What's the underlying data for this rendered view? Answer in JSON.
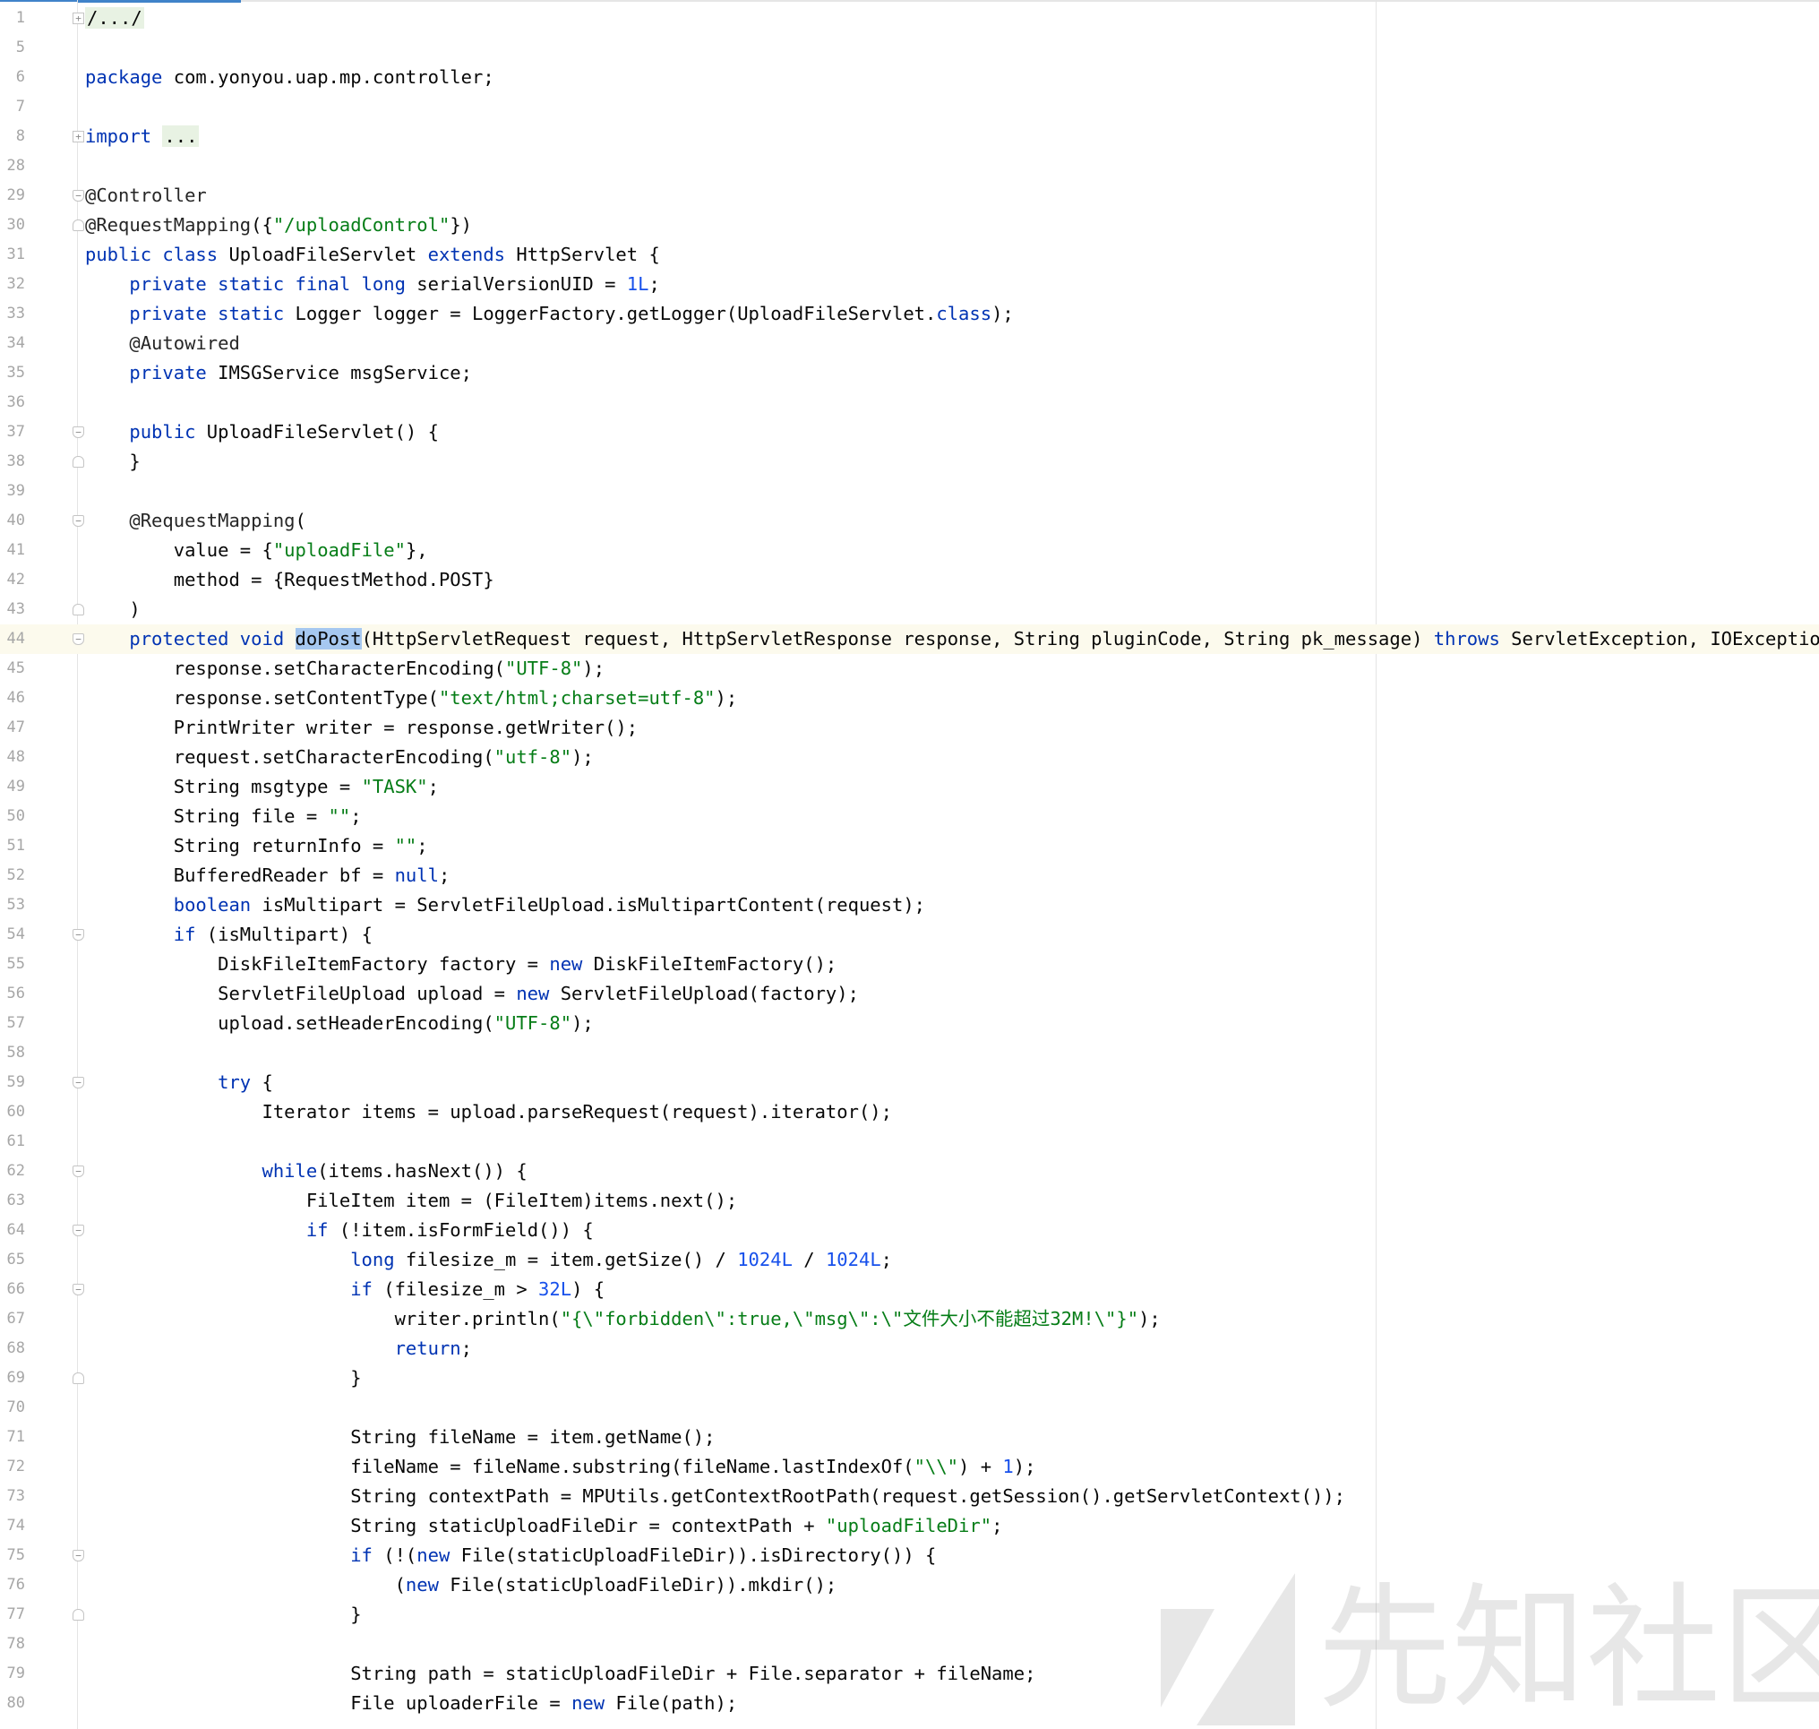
{
  "editor": {
    "lines": [
      {
        "n": "1",
        "fold": "expand",
        "tokens": [
          {
            "t": "/.../",
            "c": "fold-region"
          }
        ]
      },
      {
        "n": "5",
        "tokens": []
      },
      {
        "n": "6",
        "tokens": [
          {
            "t": "package",
            "c": "kw"
          },
          {
            "t": " com.yonyou.uap.mp.controller;"
          }
        ]
      },
      {
        "n": "7",
        "tokens": []
      },
      {
        "n": "8",
        "fold": "expand",
        "tokens": [
          {
            "t": "import",
            "c": "kw"
          },
          {
            "t": " "
          },
          {
            "t": "...",
            "c": "fold-region"
          }
        ]
      },
      {
        "n": "28",
        "tokens": []
      },
      {
        "n": "29",
        "fold": "close",
        "tokens": [
          {
            "t": "@Controller",
            "c": "ann"
          }
        ]
      },
      {
        "n": "30",
        "fold": "open",
        "tokens": [
          {
            "t": "@RequestMapping",
            "c": "ann"
          },
          {
            "t": "({"
          },
          {
            "t": "\"/uploadControl\"",
            "c": "str"
          },
          {
            "t": "})"
          }
        ]
      },
      {
        "n": "31",
        "tokens": [
          {
            "t": "public class",
            "c": "kw"
          },
          {
            "t": " UploadFileServlet "
          },
          {
            "t": "extends",
            "c": "kw"
          },
          {
            "t": " HttpServlet {"
          }
        ]
      },
      {
        "n": "32",
        "tokens": [
          {
            "t": "    "
          },
          {
            "t": "private static final long",
            "c": "kw"
          },
          {
            "t": " serialVersionUID = "
          },
          {
            "t": "1L",
            "c": "num"
          },
          {
            "t": ";"
          }
        ]
      },
      {
        "n": "33",
        "tokens": [
          {
            "t": "    "
          },
          {
            "t": "private static",
            "c": "kw"
          },
          {
            "t": " Logger logger = LoggerFactory.getLogger(UploadFileServlet."
          },
          {
            "t": "class",
            "c": "kw"
          },
          {
            "t": ");"
          }
        ]
      },
      {
        "n": "34",
        "tokens": [
          {
            "t": "    "
          },
          {
            "t": "@Autowired",
            "c": "ann"
          }
        ]
      },
      {
        "n": "35",
        "tokens": [
          {
            "t": "    "
          },
          {
            "t": "private",
            "c": "kw"
          },
          {
            "t": " IMSGService msgService;"
          }
        ]
      },
      {
        "n": "36",
        "tokens": []
      },
      {
        "n": "37",
        "fold": "close",
        "tokens": [
          {
            "t": "    "
          },
          {
            "t": "public",
            "c": "kw"
          },
          {
            "t": " UploadFileServlet() {"
          }
        ]
      },
      {
        "n": "38",
        "fold": "open",
        "tokens": [
          {
            "t": "    }"
          }
        ]
      },
      {
        "n": "39",
        "tokens": []
      },
      {
        "n": "40",
        "fold": "close",
        "tokens": [
          {
            "t": "    "
          },
          {
            "t": "@RequestMapping",
            "c": "ann"
          },
          {
            "t": "("
          }
        ]
      },
      {
        "n": "41",
        "tokens": [
          {
            "t": "        value = {"
          },
          {
            "t": "\"uploadFile\"",
            "c": "str"
          },
          {
            "t": "},"
          }
        ]
      },
      {
        "n": "42",
        "tokens": [
          {
            "t": "        method = {RequestMethod.POST}"
          }
        ]
      },
      {
        "n": "43",
        "fold": "open",
        "tokens": [
          {
            "t": "    )"
          }
        ]
      },
      {
        "n": "44",
        "current": true,
        "fold": "close",
        "tokens": [
          {
            "t": "    "
          },
          {
            "t": "protected void",
            "c": "kw"
          },
          {
            "t": " "
          },
          {
            "t": "doPost",
            "c": "sel"
          },
          {
            "t": "(HttpServletRequest request, HttpServletResponse response, String pluginCode, String pk_message) "
          },
          {
            "t": "throws",
            "c": "kw"
          },
          {
            "t": " ServletException, IOException {"
          }
        ]
      },
      {
        "n": "45",
        "tokens": [
          {
            "t": "        response.setCharacterEncoding("
          },
          {
            "t": "\"UTF-8\"",
            "c": "str"
          },
          {
            "t": ");"
          }
        ]
      },
      {
        "n": "46",
        "tokens": [
          {
            "t": "        response.setContentType("
          },
          {
            "t": "\"text/html;charset=utf-8\"",
            "c": "str"
          },
          {
            "t": ");"
          }
        ]
      },
      {
        "n": "47",
        "tokens": [
          {
            "t": "        PrintWriter writer = response.getWriter();"
          }
        ]
      },
      {
        "n": "48",
        "tokens": [
          {
            "t": "        request.setCharacterEncoding("
          },
          {
            "t": "\"utf-8\"",
            "c": "str"
          },
          {
            "t": ");"
          }
        ]
      },
      {
        "n": "49",
        "tokens": [
          {
            "t": "        String msgtype = "
          },
          {
            "t": "\"TASK\"",
            "c": "str"
          },
          {
            "t": ";"
          }
        ]
      },
      {
        "n": "50",
        "tokens": [
          {
            "t": "        String file = "
          },
          {
            "t": "\"\"",
            "c": "str"
          },
          {
            "t": ";"
          }
        ]
      },
      {
        "n": "51",
        "tokens": [
          {
            "t": "        String returnInfo = "
          },
          {
            "t": "\"\"",
            "c": "str"
          },
          {
            "t": ";"
          }
        ]
      },
      {
        "n": "52",
        "tokens": [
          {
            "t": "        BufferedReader bf = "
          },
          {
            "t": "null",
            "c": "kw"
          },
          {
            "t": ";"
          }
        ]
      },
      {
        "n": "53",
        "tokens": [
          {
            "t": "        "
          },
          {
            "t": "boolean",
            "c": "kw"
          },
          {
            "t": " isMultipart = ServletFileUpload.isMultipartContent(request);"
          }
        ]
      },
      {
        "n": "54",
        "fold": "close",
        "tokens": [
          {
            "t": "        "
          },
          {
            "t": "if",
            "c": "kw"
          },
          {
            "t": " (isMultipart) {"
          }
        ]
      },
      {
        "n": "55",
        "tokens": [
          {
            "t": "            DiskFileItemFactory factory = "
          },
          {
            "t": "new",
            "c": "kw"
          },
          {
            "t": " DiskFileItemFactory();"
          }
        ]
      },
      {
        "n": "56",
        "tokens": [
          {
            "t": "            ServletFileUpload upload = "
          },
          {
            "t": "new",
            "c": "kw"
          },
          {
            "t": " ServletFileUpload(factory);"
          }
        ]
      },
      {
        "n": "57",
        "tokens": [
          {
            "t": "            upload.setHeaderEncoding("
          },
          {
            "t": "\"UTF-8\"",
            "c": "str"
          },
          {
            "t": ");"
          }
        ]
      },
      {
        "n": "58",
        "tokens": []
      },
      {
        "n": "59",
        "fold": "close",
        "tokens": [
          {
            "t": "            "
          },
          {
            "t": "try",
            "c": "kw"
          },
          {
            "t": " {"
          }
        ]
      },
      {
        "n": "60",
        "tokens": [
          {
            "t": "                Iterator items = upload.parseRequest(request).iterator();"
          }
        ]
      },
      {
        "n": "61",
        "tokens": []
      },
      {
        "n": "62",
        "fold": "close",
        "tokens": [
          {
            "t": "                "
          },
          {
            "t": "while",
            "c": "kw"
          },
          {
            "t": "(items.hasNext()) {"
          }
        ]
      },
      {
        "n": "63",
        "tokens": [
          {
            "t": "                    FileItem item = (FileItem)items.next();"
          }
        ]
      },
      {
        "n": "64",
        "fold": "close",
        "tokens": [
          {
            "t": "                    "
          },
          {
            "t": "if",
            "c": "kw"
          },
          {
            "t": " (!item.isFormField()) {"
          }
        ]
      },
      {
        "n": "65",
        "tokens": [
          {
            "t": "                        "
          },
          {
            "t": "long",
            "c": "kw"
          },
          {
            "t": " filesize_m = item.getSize() / "
          },
          {
            "t": "1024L",
            "c": "num"
          },
          {
            "t": " / "
          },
          {
            "t": "1024L",
            "c": "num"
          },
          {
            "t": ";"
          }
        ]
      },
      {
        "n": "66",
        "fold": "close",
        "tokens": [
          {
            "t": "                        "
          },
          {
            "t": "if",
            "c": "kw"
          },
          {
            "t": " (filesize_m > "
          },
          {
            "t": "32L",
            "c": "num"
          },
          {
            "t": ") {"
          }
        ]
      },
      {
        "n": "67",
        "tokens": [
          {
            "t": "                            writer.println("
          },
          {
            "t": "\"{\\\"forbidden\\\":true,\\\"msg\\\":\\\"文件大小不能超过32M!\\\"}\"",
            "c": "str"
          },
          {
            "t": ");"
          }
        ]
      },
      {
        "n": "68",
        "tokens": [
          {
            "t": "                            "
          },
          {
            "t": "return",
            "c": "kw"
          },
          {
            "t": ";"
          }
        ]
      },
      {
        "n": "69",
        "fold": "open",
        "tokens": [
          {
            "t": "                        }"
          }
        ]
      },
      {
        "n": "70",
        "tokens": []
      },
      {
        "n": "71",
        "tokens": [
          {
            "t": "                        String fileName = item.getName();"
          }
        ]
      },
      {
        "n": "72",
        "tokens": [
          {
            "t": "                        fileName = fileName.substring(fileName.lastIndexOf("
          },
          {
            "t": "\"\\\\\"",
            "c": "str"
          },
          {
            "t": ") + "
          },
          {
            "t": "1",
            "c": "num"
          },
          {
            "t": ");"
          }
        ]
      },
      {
        "n": "73",
        "tokens": [
          {
            "t": "                        String contextPath = MPUtils.getContextRootPath(request.getSession().getServletContext());"
          }
        ]
      },
      {
        "n": "74",
        "tokens": [
          {
            "t": "                        String staticUploadFileDir = contextPath + "
          },
          {
            "t": "\"uploadFileDir\"",
            "c": "str"
          },
          {
            "t": ";"
          }
        ]
      },
      {
        "n": "75",
        "fold": "close",
        "tokens": [
          {
            "t": "                        "
          },
          {
            "t": "if",
            "c": "kw"
          },
          {
            "t": " (!("
          },
          {
            "t": "new",
            "c": "kw"
          },
          {
            "t": " File(staticUploadFileDir)).isDirectory()) {"
          }
        ]
      },
      {
        "n": "76",
        "tokens": [
          {
            "t": "                            ("
          },
          {
            "t": "new",
            "c": "kw"
          },
          {
            "t": " File(staticUploadFileDir)).mkdir();"
          }
        ]
      },
      {
        "n": "77",
        "fold": "open",
        "tokens": [
          {
            "t": "                        }"
          }
        ]
      },
      {
        "n": "78",
        "tokens": []
      },
      {
        "n": "79",
        "tokens": [
          {
            "t": "                        String path = staticUploadFileDir + File.separator + fileName;"
          }
        ]
      },
      {
        "n": "80",
        "tokens": [
          {
            "t": "                        File uploaderFile = "
          },
          {
            "t": "new",
            "c": "kw"
          },
          {
            "t": " File(path);"
          }
        ]
      }
    ]
  },
  "watermark": {
    "text": "先知社区",
    "icon": "xianzhi-logo-icon"
  },
  "colors": {
    "keyword": "#0033b3",
    "string": "#067d17",
    "number": "#1750eb",
    "text": "#080808",
    "selection": "#a6c8f0",
    "current_line": "#fcfaed",
    "line_number": "#a6a6a6"
  }
}
